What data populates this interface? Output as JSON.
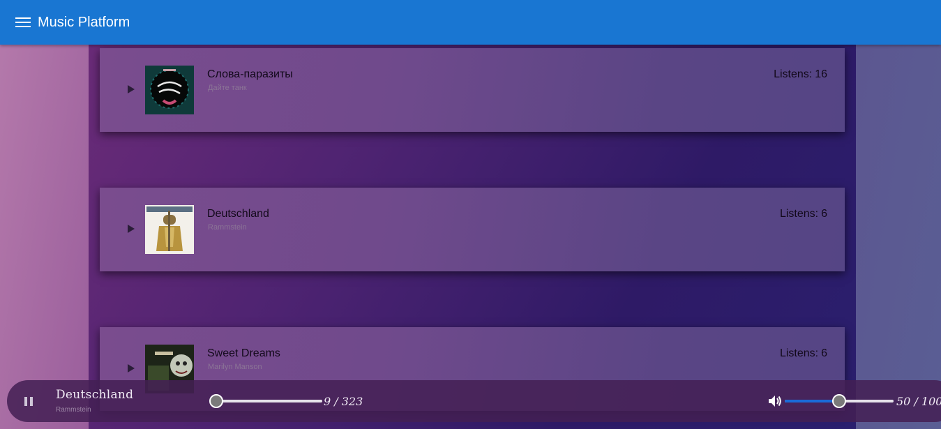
{
  "app": {
    "title": "Music Platform",
    "menu_icon": "hamburger-menu-icon"
  },
  "tracks": [
    {
      "title": "Слова-паразиты",
      "artist": "Дайте танк",
      "listens_label": "Listens:",
      "listens": "16"
    },
    {
      "title": "Deutschland",
      "artist": "Rammstein",
      "listens_label": "Listens:",
      "listens": "6"
    },
    {
      "title": "Sweet Dreams",
      "artist": "Marilyn Manson",
      "listens_label": "Listens:",
      "listens": "6"
    }
  ],
  "player": {
    "title": "Deutschland",
    "artist": "Rammstein",
    "state_icon": "pause-icon",
    "time_label": "9 / 323",
    "position": 9,
    "duration": 323,
    "volume_label": "50 / 100",
    "volume": 50,
    "volume_max": 100,
    "volume_icon": "volume-icon"
  },
  "colors": {
    "appbar": "#1976d2",
    "accent": "#1a6bd8"
  }
}
